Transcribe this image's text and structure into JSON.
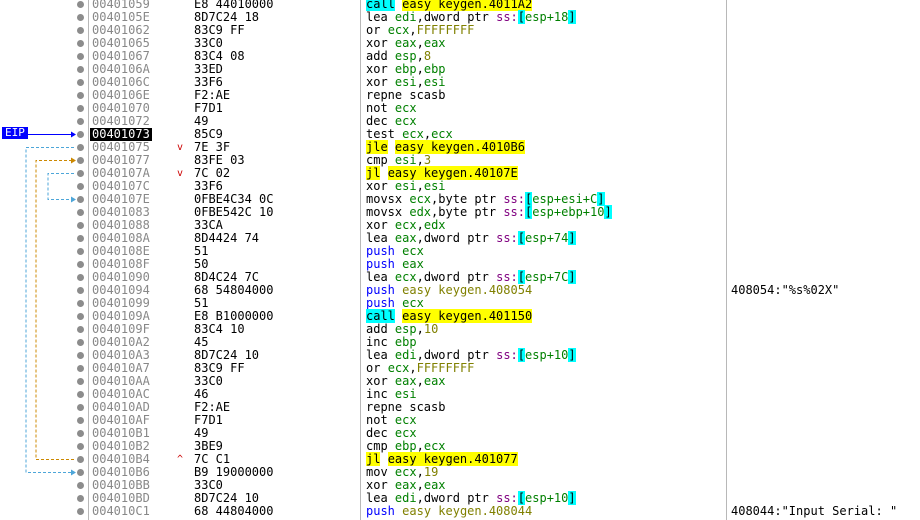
{
  "eip_label": "EIP",
  "rows": [
    {
      "addr": "00401059",
      "bytes": "E8 44010000",
      "mn": "call",
      "mnc": "call",
      "ops": [
        {
          "t": "easy keygen.4011A2",
          "c": "tgt"
        }
      ]
    },
    {
      "addr": "0040105E",
      "bytes": "8D7C24 18",
      "mn": "lea",
      "ops": [
        {
          "t": "edi",
          "c": "reg"
        },
        {
          "t": ",",
          "c": ""
        },
        {
          "t": "dword ptr",
          "c": ""
        },
        {
          "t": " ",
          "c": ""
        },
        {
          "t": "ss:",
          "c": "seg"
        },
        {
          "t": "[",
          "c": "bk"
        },
        {
          "t": "esp+18",
          "c": "mem"
        },
        {
          "t": "]",
          "c": "bk"
        }
      ]
    },
    {
      "addr": "00401062",
      "bytes": "83C9 FF",
      "mn": "or",
      "ops": [
        {
          "t": "ecx",
          "c": "reg"
        },
        {
          "t": ",",
          "c": ""
        },
        {
          "t": "FFFFFFFF",
          "c": "num"
        }
      ]
    },
    {
      "addr": "00401065",
      "bytes": "33C0",
      "mn": "xor",
      "ops": [
        {
          "t": "eax",
          "c": "reg"
        },
        {
          "t": ",",
          "c": ""
        },
        {
          "t": "eax",
          "c": "reg"
        }
      ]
    },
    {
      "addr": "00401067",
      "bytes": "83C4 08",
      "mn": "add",
      "ops": [
        {
          "t": "esp",
          "c": "reg"
        },
        {
          "t": ",",
          "c": ""
        },
        {
          "t": "8",
          "c": "num"
        }
      ]
    },
    {
      "addr": "0040106A",
      "bytes": "33ED",
      "mn": "xor",
      "ops": [
        {
          "t": "ebp",
          "c": "reg"
        },
        {
          "t": ",",
          "c": ""
        },
        {
          "t": "ebp",
          "c": "reg"
        }
      ]
    },
    {
      "addr": "0040106C",
      "bytes": "33F6",
      "mn": "xor",
      "ops": [
        {
          "t": "esi",
          "c": "reg"
        },
        {
          "t": ",",
          "c": ""
        },
        {
          "t": "esi",
          "c": "reg"
        }
      ]
    },
    {
      "addr": "0040106E",
      "bytes": "F2:AE",
      "mn": "repne scasb",
      "ops": []
    },
    {
      "addr": "00401070",
      "bytes": "F7D1",
      "mn": "not",
      "ops": [
        {
          "t": "ecx",
          "c": "reg"
        }
      ]
    },
    {
      "addr": "00401072",
      "bytes": "49",
      "mn": "dec",
      "ops": [
        {
          "t": "ecx",
          "c": "reg"
        }
      ]
    },
    {
      "addr": "00401073",
      "bytes": "85C9",
      "mn": "test",
      "current": true,
      "ops": [
        {
          "t": "ecx",
          "c": "reg"
        },
        {
          "t": ",",
          "c": ""
        },
        {
          "t": "ecx",
          "c": "reg"
        }
      ]
    },
    {
      "addr": "00401075",
      "bytes": "7E 3F",
      "arrow": "down",
      "mn": "jle",
      "mnc": "jmp",
      "ops": [
        {
          "t": "easy keygen.4010B6",
          "c": "tgt"
        }
      ]
    },
    {
      "addr": "00401077",
      "bytes": "83FE 03",
      "mn": "cmp",
      "ops": [
        {
          "t": "esi",
          "c": "reg"
        },
        {
          "t": ",",
          "c": ""
        },
        {
          "t": "3",
          "c": "num"
        }
      ]
    },
    {
      "addr": "0040107A",
      "bytes": "7C 02",
      "arrow": "down",
      "mn": "jl",
      "mnc": "jmp",
      "ops": [
        {
          "t": "easy keygen.40107E",
          "c": "tgt"
        }
      ]
    },
    {
      "addr": "0040107C",
      "bytes": "33F6",
      "mn": "xor",
      "ops": [
        {
          "t": "esi",
          "c": "reg"
        },
        {
          "t": ",",
          "c": ""
        },
        {
          "t": "esi",
          "c": "reg"
        }
      ]
    },
    {
      "addr": "0040107E",
      "bytes": "0FBE4C34 0C",
      "mn": "movsx",
      "ops": [
        {
          "t": "ecx",
          "c": "reg"
        },
        {
          "t": ",",
          "c": ""
        },
        {
          "t": "byte ptr",
          "c": ""
        },
        {
          "t": " ",
          "c": ""
        },
        {
          "t": "ss:",
          "c": "seg"
        },
        {
          "t": "[",
          "c": "bk"
        },
        {
          "t": "esp+esi+C",
          "c": "mem"
        },
        {
          "t": "]",
          "c": "bk"
        }
      ]
    },
    {
      "addr": "00401083",
      "bytes": "0FBE542C 10",
      "mn": "movsx",
      "ops": [
        {
          "t": "edx",
          "c": "reg"
        },
        {
          "t": ",",
          "c": ""
        },
        {
          "t": "byte ptr",
          "c": ""
        },
        {
          "t": " ",
          "c": ""
        },
        {
          "t": "ss:",
          "c": "seg"
        },
        {
          "t": "[",
          "c": "bk"
        },
        {
          "t": "esp+ebp+10",
          "c": "mem"
        },
        {
          "t": "]",
          "c": "bk"
        }
      ]
    },
    {
      "addr": "00401088",
      "bytes": "33CA",
      "mn": "xor",
      "ops": [
        {
          "t": "ecx",
          "c": "reg"
        },
        {
          "t": ",",
          "c": ""
        },
        {
          "t": "edx",
          "c": "reg"
        }
      ]
    },
    {
      "addr": "0040108A",
      "bytes": "8D4424 74",
      "mn": "lea",
      "ops": [
        {
          "t": "eax",
          "c": "reg"
        },
        {
          "t": ",",
          "c": ""
        },
        {
          "t": "dword ptr",
          "c": ""
        },
        {
          "t": " ",
          "c": ""
        },
        {
          "t": "ss:",
          "c": "seg"
        },
        {
          "t": "[",
          "c": "bk"
        },
        {
          "t": "esp+74",
          "c": "mem"
        },
        {
          "t": "]",
          "c": "bk"
        }
      ]
    },
    {
      "addr": "0040108E",
      "bytes": "51",
      "mn": "push",
      "mnc": "push",
      "ops": [
        {
          "t": "ecx",
          "c": "reg"
        }
      ]
    },
    {
      "addr": "0040108F",
      "bytes": "50",
      "mn": "push",
      "mnc": "push",
      "ops": [
        {
          "t": "eax",
          "c": "reg"
        }
      ]
    },
    {
      "addr": "00401090",
      "bytes": "8D4C24 7C",
      "mn": "lea",
      "ops": [
        {
          "t": "ecx",
          "c": "reg"
        },
        {
          "t": ",",
          "c": ""
        },
        {
          "t": "dword ptr",
          "c": ""
        },
        {
          "t": " ",
          "c": ""
        },
        {
          "t": "ss:",
          "c": "seg"
        },
        {
          "t": "[",
          "c": "bk"
        },
        {
          "t": "esp+7C",
          "c": "mem"
        },
        {
          "t": "]",
          "c": "bk"
        }
      ]
    },
    {
      "addr": "00401094",
      "bytes": "68 54804000",
      "mn": "push",
      "mnc": "push",
      "ops": [
        {
          "t": "easy keygen.408054",
          "c": "num"
        }
      ],
      "comment": "408054:\"%s%02X\""
    },
    {
      "addr": "00401099",
      "bytes": "51",
      "mn": "push",
      "mnc": "push",
      "ops": [
        {
          "t": "ecx",
          "c": "reg"
        }
      ]
    },
    {
      "addr": "0040109A",
      "bytes": "E8 B1000000",
      "mn": "call",
      "mnc": "call",
      "ops": [
        {
          "t": "easy keygen.401150",
          "c": "tgt"
        }
      ]
    },
    {
      "addr": "0040109F",
      "bytes": "83C4 10",
      "mn": "add",
      "ops": [
        {
          "t": "esp",
          "c": "reg"
        },
        {
          "t": ",",
          "c": ""
        },
        {
          "t": "10",
          "c": "num"
        }
      ]
    },
    {
      "addr": "004010A2",
      "bytes": "45",
      "mn": "inc",
      "ops": [
        {
          "t": "ebp",
          "c": "reg"
        }
      ]
    },
    {
      "addr": "004010A3",
      "bytes": "8D7C24 10",
      "mn": "lea",
      "ops": [
        {
          "t": "edi",
          "c": "reg"
        },
        {
          "t": ",",
          "c": ""
        },
        {
          "t": "dword ptr",
          "c": ""
        },
        {
          "t": " ",
          "c": ""
        },
        {
          "t": "ss:",
          "c": "seg"
        },
        {
          "t": "[",
          "c": "bk"
        },
        {
          "t": "esp+10",
          "c": "mem"
        },
        {
          "t": "]",
          "c": "bk"
        }
      ]
    },
    {
      "addr": "004010A7",
      "bytes": "83C9 FF",
      "mn": "or",
      "ops": [
        {
          "t": "ecx",
          "c": "reg"
        },
        {
          "t": ",",
          "c": ""
        },
        {
          "t": "FFFFFFFF",
          "c": "num"
        }
      ]
    },
    {
      "addr": "004010AA",
      "bytes": "33C0",
      "mn": "xor",
      "ops": [
        {
          "t": "eax",
          "c": "reg"
        },
        {
          "t": ",",
          "c": ""
        },
        {
          "t": "eax",
          "c": "reg"
        }
      ]
    },
    {
      "addr": "004010AC",
      "bytes": "46",
      "mn": "inc",
      "ops": [
        {
          "t": "esi",
          "c": "reg"
        }
      ]
    },
    {
      "addr": "004010AD",
      "bytes": "F2:AE",
      "mn": "repne scasb",
      "ops": []
    },
    {
      "addr": "004010AF",
      "bytes": "F7D1",
      "mn": "not",
      "ops": [
        {
          "t": "ecx",
          "c": "reg"
        }
      ]
    },
    {
      "addr": "004010B1",
      "bytes": "49",
      "mn": "dec",
      "ops": [
        {
          "t": "ecx",
          "c": "reg"
        }
      ]
    },
    {
      "addr": "004010B2",
      "bytes": "3BE9",
      "mn": "cmp",
      "ops": [
        {
          "t": "ebp",
          "c": "reg"
        },
        {
          "t": ",",
          "c": ""
        },
        {
          "t": "ecx",
          "c": "reg"
        }
      ]
    },
    {
      "addr": "004010B4",
      "bytes": "7C C1",
      "arrow": "up",
      "mn": "jl",
      "mnc": "jmp",
      "ops": [
        {
          "t": "easy keygen.401077",
          "c": "tgt"
        }
      ]
    },
    {
      "addr": "004010B6",
      "bytes": "B9 19000000",
      "mn": "mov",
      "ops": [
        {
          "t": "ecx",
          "c": "reg"
        },
        {
          "t": ",",
          "c": ""
        },
        {
          "t": "19",
          "c": "num"
        }
      ]
    },
    {
      "addr": "004010BB",
      "bytes": "33C0",
      "mn": "xor",
      "ops": [
        {
          "t": "eax",
          "c": "reg"
        },
        {
          "t": ",",
          "c": ""
        },
        {
          "t": "eax",
          "c": "reg"
        }
      ]
    },
    {
      "addr": "004010BD",
      "bytes": "8D7C24 10",
      "mn": "lea",
      "ops": [
        {
          "t": "edi",
          "c": "reg"
        },
        {
          "t": ",",
          "c": ""
        },
        {
          "t": "dword ptr",
          "c": ""
        },
        {
          "t": " ",
          "c": ""
        },
        {
          "t": "ss:",
          "c": "seg"
        },
        {
          "t": "[",
          "c": "bk"
        },
        {
          "t": "esp+10",
          "c": "mem"
        },
        {
          "t": "]",
          "c": "bk"
        }
      ]
    },
    {
      "addr": "004010C1",
      "bytes": "68 44804000",
      "mn": "push",
      "mnc": "push",
      "ops": [
        {
          "t": "easy keygen.408044",
          "c": "num"
        }
      ],
      "comment": "408044:\"Input Serial: \""
    }
  ],
  "colors": {
    "eip_arrow": "#0000ff",
    "jump_down": "#cc8800",
    "jump_up": "#cc8800",
    "loop_line": "#4da6d9"
  }
}
